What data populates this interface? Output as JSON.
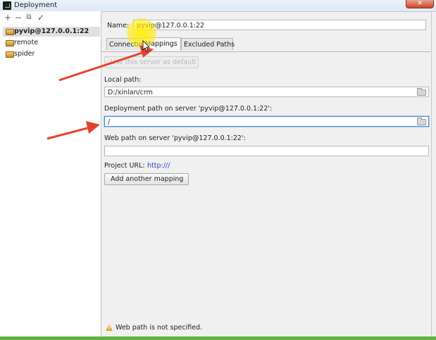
{
  "window": {
    "title": "Deployment",
    "close_label": "✕"
  },
  "toolbar": {
    "add": "+",
    "remove": "−",
    "copy": "⧉",
    "apply": "✓"
  },
  "servers": [
    {
      "label": "pyvip@127.0.0.1:22",
      "selected": true
    },
    {
      "label": "remote",
      "selected": false
    },
    {
      "label": "spider",
      "selected": false
    }
  ],
  "form": {
    "name_label": "Name:",
    "name_value": "pyvip@127.0.0.1:22",
    "tabs": [
      {
        "label": "Connection",
        "active": false
      },
      {
        "label": "Mappings",
        "active": true
      },
      {
        "label": "Excluded Paths",
        "active": false
      }
    ],
    "use_default_button": "Use this server as default",
    "local_path_label": "Local path:",
    "local_path_value": "D:/xinlan/crm",
    "deployment_path_label": "Deployment path on server 'pyvip@127.0.0.1:22':",
    "deployment_path_value": "/",
    "web_path_label": "Web path on server 'pyvip@127.0.0.1:22':",
    "web_path_value": "",
    "project_url_label": "Project URL:",
    "project_url_value": "http:///",
    "add_mapping_button": "Add another mapping",
    "warning_text": "Web path is not specified."
  },
  "colors": {
    "accent": "#4f8fd6",
    "warning": "#e8a21b",
    "annotation_arrow": "#e8412b",
    "highlight": "#fff000"
  }
}
